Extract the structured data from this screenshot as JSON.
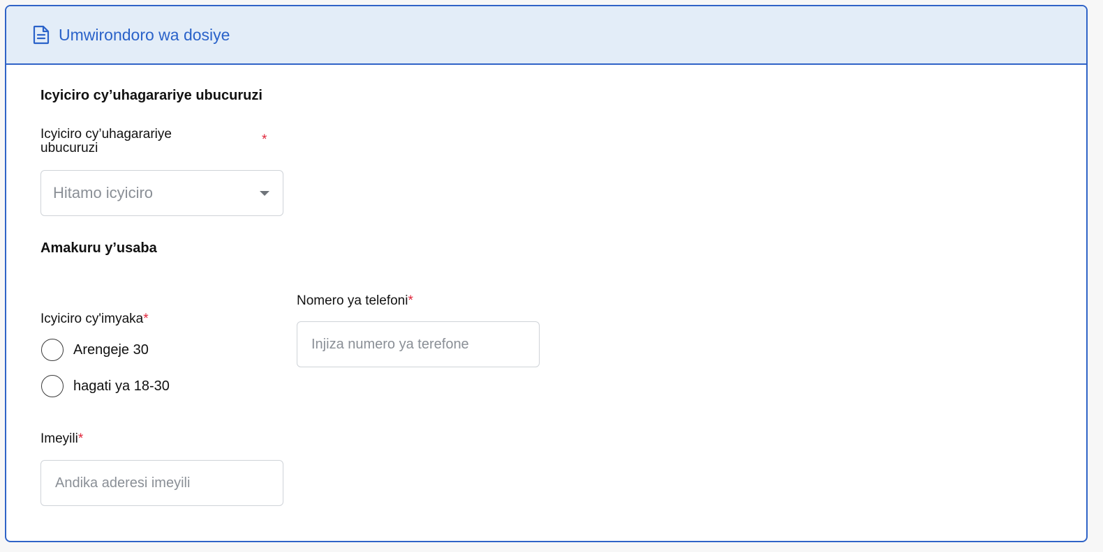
{
  "header": {
    "title": "Umwirondoro wa dosiye",
    "icon": "document-icon"
  },
  "business_section": {
    "title": "Icyiciro cy’uhagarariye ubucuruzi",
    "field_label_line1": "Icyiciro cy’uhagarariye",
    "field_label_line2": "ubucuruzi",
    "required_mark": "*",
    "select_placeholder": "Hitamo icyiciro"
  },
  "applicant_section": {
    "title": "Amakuru y’usaba",
    "age_label": "Icyiciro cy'imyaka",
    "age_options": [
      "Arengeje 30",
      "hagati ya 18-30"
    ],
    "phone_label": "Nomero ya telefoni",
    "phone_placeholder": "Injiza numero ya terefone",
    "email_label": "Imeyili",
    "email_placeholder": "Andika aderesi imeyili",
    "required_mark": "*"
  },
  "colors": {
    "accent": "#2f63c7",
    "header_bg": "#e3edf8",
    "required": "#e0253a"
  }
}
